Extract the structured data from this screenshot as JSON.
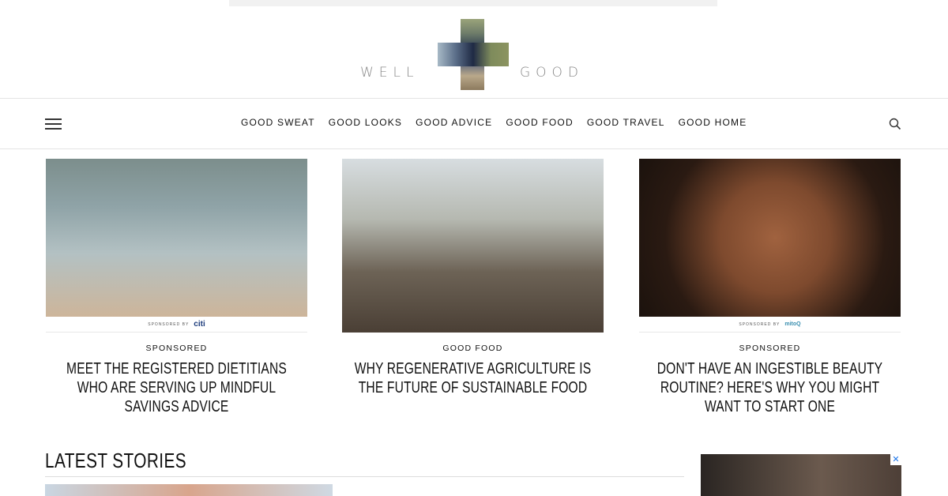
{
  "brand": {
    "word_left": "WELL",
    "word_right": "GOOD"
  },
  "nav": {
    "menu_icon": "hamburger-icon",
    "items": [
      {
        "label": "GOOD SWEAT"
      },
      {
        "label": "GOOD LOOKS"
      },
      {
        "label": "GOOD ADVICE"
      },
      {
        "label": "GOOD FOOD"
      },
      {
        "label": "GOOD TRAVEL"
      },
      {
        "label": "GOOD HOME"
      }
    ],
    "search_icon": "search-icon"
  },
  "featured": [
    {
      "sponsor_prefix": "SPONSORED BY",
      "sponsor_name": "citi",
      "category": "SPONSORED",
      "headline": "Meet the registered dietitians who are serving up mindful savings advice"
    },
    {
      "category": "GOOD FOOD",
      "headline": "Why regenerative agriculture is the future of sustainable food"
    },
    {
      "sponsor_prefix": "SPONSORED BY",
      "sponsor_name": "mitoQ",
      "category": "SPONSORED",
      "headline": "Don't have an ingestible beauty routine? Here's why you might want to start one"
    }
  ],
  "latest": {
    "title": "LATEST STORIES"
  },
  "ad": {
    "close_label": "✕"
  },
  "colors": {
    "text": "#111111",
    "nav_border": "#e4e4e4",
    "logo_gray": "#888888"
  }
}
